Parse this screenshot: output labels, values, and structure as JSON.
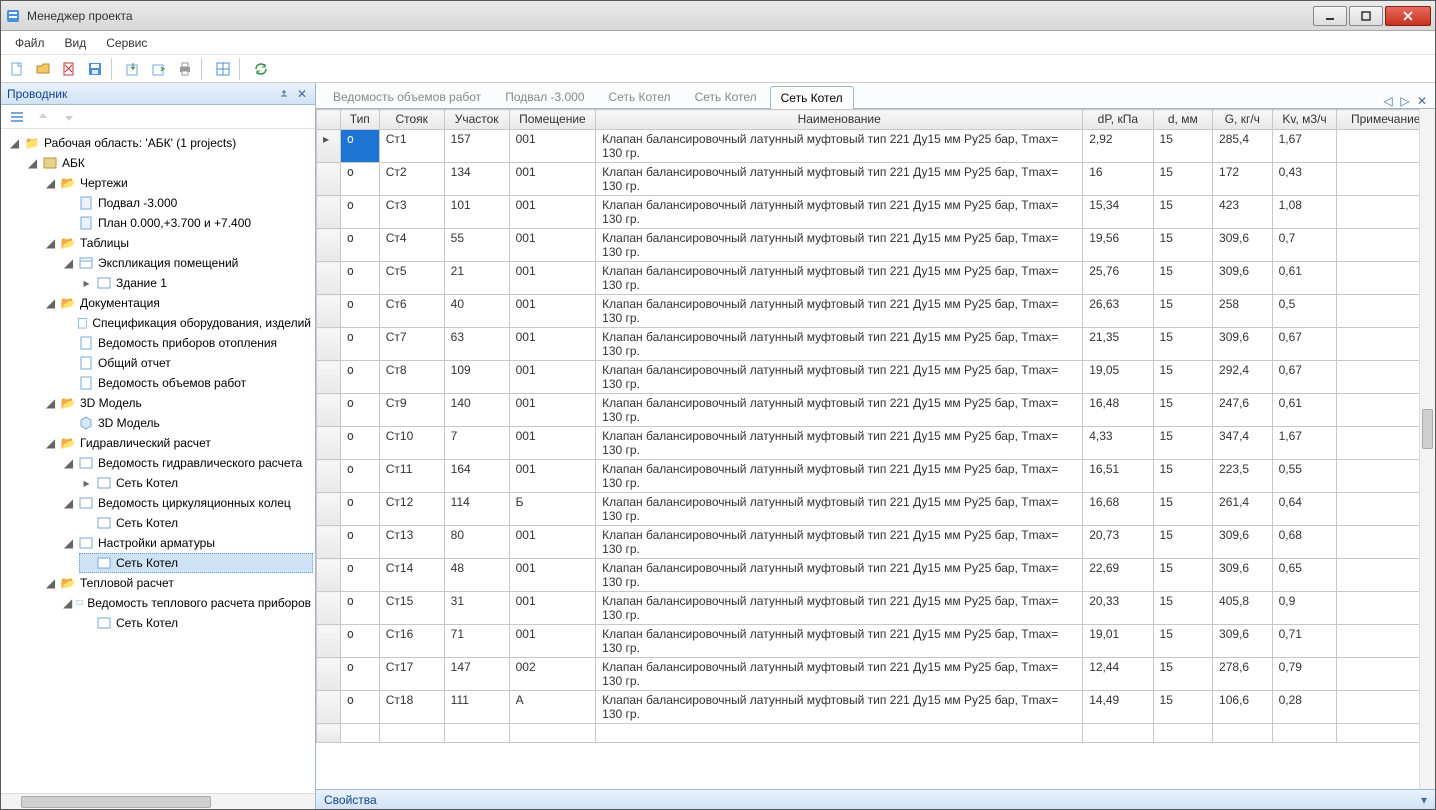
{
  "window": {
    "title": "Менеджер проекта"
  },
  "menu": {
    "file": "Файл",
    "view": "Вид",
    "service": "Сервис"
  },
  "explorer": {
    "title": "Проводник",
    "root": "Рабочая область: 'АБК' (1 projects)",
    "nodes": {
      "abk": "АБК",
      "drawings": "Чертежи",
      "basement": "Подвал -3.000",
      "plan": "План 0.000,+3.700 и +7.400",
      "tables": "Таблицы",
      "explication": "Экспликация помещений",
      "building1": "Здание 1",
      "documentation": "Документация",
      "spec_equip": "Спецификация оборудования, изделий",
      "heating_devices": "Ведомость приборов отопления",
      "general_report": "Общий отчет",
      "volumes": "Ведомость объемов работ",
      "model3d_folder": "3D Модель",
      "model3d": "3D Модель",
      "hydraulic": "Гидравлический расчет",
      "hydraulic_list": "Ведомость гидравлического расчета",
      "boiler1": "Сеть Котел",
      "circ_rings": "Ведомость циркуляционных колец",
      "boiler2": "Сеть Котел",
      "fittings": "Настройки арматуры",
      "boiler3": "Сеть Котел",
      "thermal": "Тепловой расчет",
      "thermal_list": "Ведомость теплового расчета приборов",
      "boiler4": "Сеть Котел"
    }
  },
  "tabs": [
    {
      "label": "Ведомость объемов работ",
      "active": false
    },
    {
      "label": "Подвал -3.000",
      "active": false
    },
    {
      "label": "Сеть Котел",
      "active": false
    },
    {
      "label": "Сеть Котел",
      "active": false
    },
    {
      "label": "Сеть Котел",
      "active": true
    }
  ],
  "grid": {
    "columns": [
      "",
      "Тип",
      "Стояк",
      "Участок",
      "Помещение",
      "Наименование",
      "dP, кПа",
      "d, мм",
      "G, кг/ч",
      "Kv, м3/ч",
      "Примечание"
    ],
    "rows": [
      {
        "type": "o",
        "riser": "Ст1",
        "section": "157",
        "room": "001",
        "name": "Клапан балансировочный латунный муфтовый тип 221 Ду15 мм Ру25 бар, Tmax= 130 гр.",
        "dp": "2,92",
        "d": "15",
        "g": "285,4",
        "kv": "1,67",
        "note": "",
        "sel": true,
        "caret": true
      },
      {
        "type": "o",
        "riser": "Ст2",
        "section": "134",
        "room": "001",
        "name": "Клапан балансировочный латунный муфтовый тип 221 Ду15 мм Ру25 бар, Tmax= 130 гр.",
        "dp": "16",
        "d": "15",
        "g": "172",
        "kv": "0,43",
        "note": ""
      },
      {
        "type": "o",
        "riser": "Ст3",
        "section": "101",
        "room": "001",
        "name": "Клапан балансировочный латунный муфтовый тип 221 Ду15 мм Ру25 бар, Tmax= 130 гр.",
        "dp": "15,34",
        "d": "15",
        "g": "423",
        "kv": "1,08",
        "note": ""
      },
      {
        "type": "o",
        "riser": "Ст4",
        "section": "55",
        "room": "001",
        "name": "Клапан балансировочный латунный муфтовый тип 221 Ду15 мм Ру25 бар, Tmax= 130 гр.",
        "dp": "19,56",
        "d": "15",
        "g": "309,6",
        "kv": "0,7",
        "note": ""
      },
      {
        "type": "o",
        "riser": "Ст5",
        "section": "21",
        "room": "001",
        "name": "Клапан балансировочный латунный муфтовый тип 221 Ду15 мм Ру25 бар, Tmax= 130 гр.",
        "dp": "25,76",
        "d": "15",
        "g": "309,6",
        "kv": "0,61",
        "note": ""
      },
      {
        "type": "o",
        "riser": "Ст6",
        "section": "40",
        "room": "001",
        "name": "Клапан балансировочный латунный муфтовый тип 221 Ду15 мм Ру25 бар, Tmax= 130 гр.",
        "dp": "26,63",
        "d": "15",
        "g": "258",
        "kv": "0,5",
        "note": ""
      },
      {
        "type": "o",
        "riser": "Ст7",
        "section": "63",
        "room": "001",
        "name": "Клапан балансировочный латунный муфтовый тип 221 Ду15 мм Ру25 бар, Tmax= 130 гр.",
        "dp": "21,35",
        "d": "15",
        "g": "309,6",
        "kv": "0,67",
        "note": ""
      },
      {
        "type": "o",
        "riser": "Ст8",
        "section": "109",
        "room": "001",
        "name": "Клапан балансировочный латунный муфтовый тип 221 Ду15 мм Ру25 бар, Tmax= 130 гр.",
        "dp": "19,05",
        "d": "15",
        "g": "292,4",
        "kv": "0,67",
        "note": ""
      },
      {
        "type": "o",
        "riser": "Ст9",
        "section": "140",
        "room": "001",
        "name": "Клапан балансировочный латунный муфтовый тип 221 Ду15 мм Ру25 бар, Tmax= 130 гр.",
        "dp": "16,48",
        "d": "15",
        "g": "247,6",
        "kv": "0,61",
        "note": ""
      },
      {
        "type": "o",
        "riser": "Ст10",
        "section": "7",
        "room": "001",
        "name": "Клапан балансировочный латунный муфтовый тип 221 Ду15 мм Ру25 бар, Tmax= 130 гр.",
        "dp": "4,33",
        "d": "15",
        "g": "347,4",
        "kv": "1,67",
        "note": ""
      },
      {
        "type": "o",
        "riser": "Ст11",
        "section": "164",
        "room": "001",
        "name": "Клапан балансировочный латунный муфтовый тип 221 Ду15 мм Ру25 бар, Tmax= 130 гр.",
        "dp": "16,51",
        "d": "15",
        "g": "223,5",
        "kv": "0,55",
        "note": ""
      },
      {
        "type": "o",
        "riser": "Ст12",
        "section": "114",
        "room": "Б",
        "name": "Клапан балансировочный латунный муфтовый тип 221 Ду15 мм Ру25 бар, Tmax= 130 гр.",
        "dp": "16,68",
        "d": "15",
        "g": "261,4",
        "kv": "0,64",
        "note": ""
      },
      {
        "type": "o",
        "riser": "Ст13",
        "section": "80",
        "room": "001",
        "name": "Клапан балансировочный латунный муфтовый тип 221 Ду15 мм Ру25 бар, Tmax= 130 гр.",
        "dp": "20,73",
        "d": "15",
        "g": "309,6",
        "kv": "0,68",
        "note": ""
      },
      {
        "type": "o",
        "riser": "Ст14",
        "section": "48",
        "room": "001",
        "name": "Клапан балансировочный латунный муфтовый тип 221 Ду15 мм Ру25 бар, Tmax= 130 гр.",
        "dp": "22,69",
        "d": "15",
        "g": "309,6",
        "kv": "0,65",
        "note": ""
      },
      {
        "type": "o",
        "riser": "Ст15",
        "section": "31",
        "room": "001",
        "name": "Клапан балансировочный латунный муфтовый тип 221 Ду15 мм Ру25 бар, Tmax= 130 гр.",
        "dp": "20,33",
        "d": "15",
        "g": "405,8",
        "kv": "0,9",
        "note": ""
      },
      {
        "type": "o",
        "riser": "Ст16",
        "section": "71",
        "room": "001",
        "name": "Клапан балансировочный латунный муфтовый тип 221 Ду15 мм Ру25 бар, Tmax= 130 гр.",
        "dp": "19,01",
        "d": "15",
        "g": "309,6",
        "kv": "0,71",
        "note": ""
      },
      {
        "type": "o",
        "riser": "Ст17",
        "section": "147",
        "room": "002",
        "name": "Клапан балансировочный латунный муфтовый тип 221 Ду15 мм Ру25 бар, Tmax= 130 гр.",
        "dp": "12,44",
        "d": "15",
        "g": "278,6",
        "kv": "0,79",
        "note": ""
      },
      {
        "type": "o",
        "riser": "Ст18",
        "section": "111",
        "room": "А",
        "name": "Клапан балансировочный латунный муфтовый тип 221 Ду15 мм Ру25 бар, Tmax= 130 гр.",
        "dp": "14,49",
        "d": "15",
        "g": "106,6",
        "kv": "0,28",
        "note": ""
      }
    ]
  },
  "properties": {
    "title": "Свойства"
  }
}
